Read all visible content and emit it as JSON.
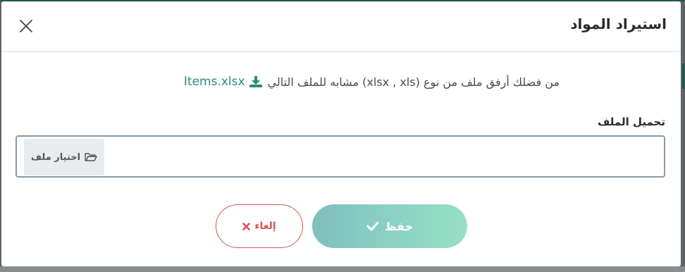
{
  "modal": {
    "title": "استيراد المواد",
    "note_text": "من فضلك أرفق ملف من نوع (xlsx , xls) مشابه للملف التالي",
    "template_link": "Items.xlsx",
    "upload_label": "تحميل الملف",
    "choose_file_label": "اختيار ملف",
    "save_label": "حفظ",
    "cancel_label": "إلغاء"
  },
  "icons": {
    "close": "close-icon",
    "download": "download-icon",
    "folder": "folder-open-icon",
    "check": "check-icon",
    "times": "times-icon"
  },
  "colors": {
    "accent": "#2a8a7a",
    "danger": "#d9534f",
    "save_gradient_start": "#7fbfbf",
    "save_gradient_end": "#97e0c4"
  }
}
